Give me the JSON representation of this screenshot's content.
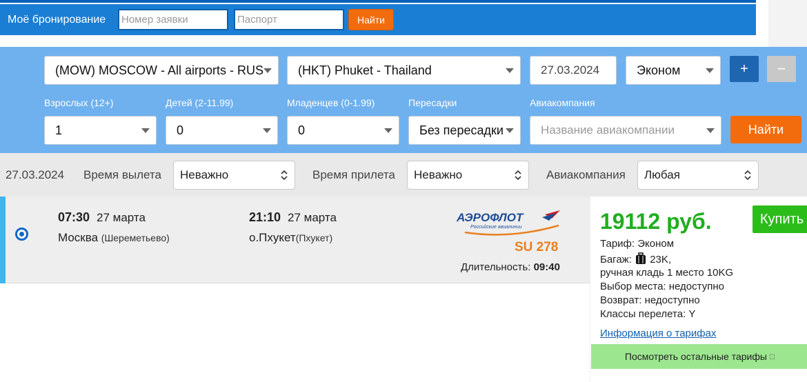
{
  "booking": {
    "title": "Моё бронирование",
    "order_placeholder": "Номер заявки",
    "passport_placeholder": "Паспорт",
    "find_label": "Найти"
  },
  "search": {
    "from": "(MOW) MOSCOW - All airports - RUS",
    "to": "(HKT) Phuket - Thailand",
    "date": "27.03.2024",
    "cabin": "Эконом",
    "plus_label": "+",
    "minus_label": "−",
    "adults_label": "Взрослых (12+)",
    "adults_value": "1",
    "children_label": "Детей (2-11.99)",
    "children_value": "0",
    "infants_label": "Младенцев (0-1.99)",
    "infants_value": "0",
    "transfers_label": "Пересадки",
    "transfers_value": "Без пересадки",
    "airline_label": "Авиакомпания",
    "airline_placeholder": "Название авиакомпании",
    "find_label": "Найти"
  },
  "filters": {
    "date": "27.03.2024",
    "departure_label": "Время вылета",
    "departure_value": "Неважно",
    "arrival_label": "Время прилета",
    "arrival_value": "Неважно",
    "airline_label": "Авиакомпания",
    "airline_value": "Любая"
  },
  "flight": {
    "dep_time": "07:30",
    "dep_date": "27 марта",
    "dep_city": "Москва",
    "dep_airport": "(Шереметьево)",
    "arr_time": "21:10",
    "arr_date": "27 марта",
    "arr_city": "о.Пхукет",
    "arr_airport": "(Пхукет)",
    "airline_logo_text": "АЭРОФЛОТ",
    "airline_logo_sub": "Российские авиалинии",
    "flight_number": "SU 278",
    "duration_label": "Длительность:",
    "duration_value": "09:40"
  },
  "offer": {
    "price": "19112 руб.",
    "buy_label": "Купить",
    "tariff": "Тариф: Эконом",
    "baggage_prefix": "Багаж:",
    "baggage_value": "23K,",
    "hand_luggage": "ручная кладь 1 место 10KG",
    "seat_choice": "Выбор места: недоступно",
    "refund": "Возврат: недоступно",
    "classes": "Классы перелета: Y",
    "tariff_info_link": "Информация о тарифах",
    "other_tariffs": "Посмотреть остальные тарифы",
    "other_tariffs_icon": "□"
  },
  "colors": {
    "booking_bar": "#1a7fd4",
    "search_panel": "#6fb1ee",
    "accent_orange": "#f26c0d",
    "price_green": "#1fae1f",
    "flight_number": "#e8801f"
  }
}
